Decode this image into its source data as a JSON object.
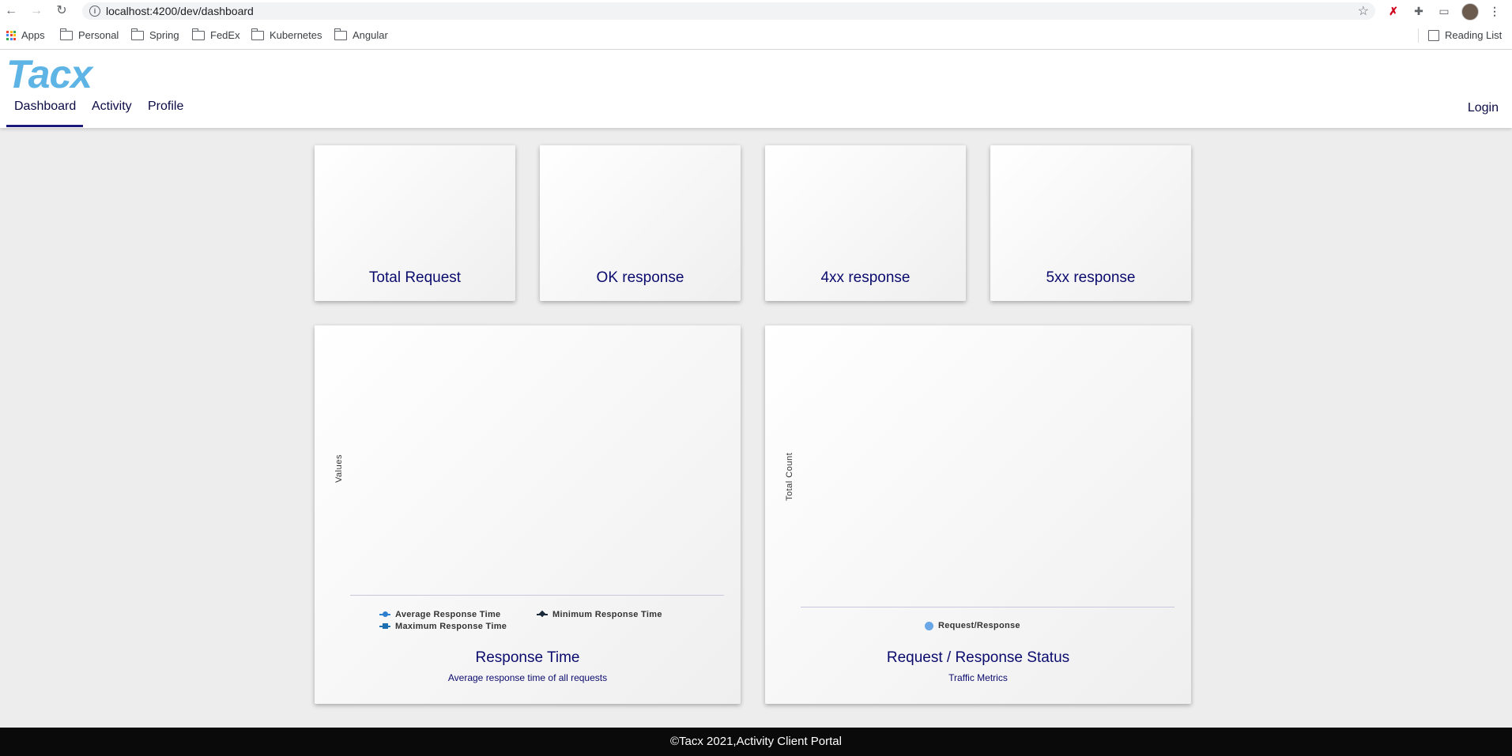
{
  "browser": {
    "url": "localhost:4200/dev/dashboard",
    "bookmarks": [
      "Apps",
      "Personal",
      "Spring",
      "FedEx",
      "Kubernetes",
      "Angular"
    ],
    "reading_list": "Reading List"
  },
  "app": {
    "logo": "Tacx",
    "nav": [
      "Dashboard",
      "Activity",
      "Profile"
    ],
    "active_tab": "Dashboard",
    "login": "Login"
  },
  "stats": [
    "Total Request",
    "OK response",
    "4xx response",
    "5xx response"
  ],
  "charts": {
    "response_time": {
      "ylabel": "Values",
      "legend": [
        "Average Response Time",
        "Minimum Response Time",
        "Maximum Response Time"
      ],
      "title": "Response Time",
      "subtitle": "Average response time of all requests"
    },
    "status": {
      "ylabel": "Total Count",
      "legend": [
        "Request/Response"
      ],
      "title": "Request / Response Status",
      "subtitle": "Traffic Metrics"
    }
  },
  "colors": {
    "logo": "#5fb4e6",
    "title_text": "#0b0b6e",
    "avg_series": "#2f7fd0",
    "min_series": "#1b2a3a",
    "max_series": "#1c6fb0",
    "status_series": "#6aa7e6"
  },
  "footer": "©Tacx 2021,Activity Client Portal"
}
